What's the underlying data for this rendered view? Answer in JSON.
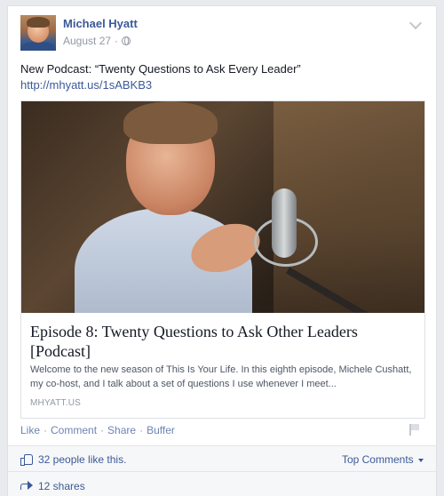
{
  "post": {
    "author": "Michael Hyatt",
    "date": "August 27",
    "date_sep": "·",
    "text": "New Podcast: “Twenty Questions to Ask Every Leader”",
    "link": "http://mhyatt.us/1sABKB3"
  },
  "share": {
    "title": "Episode 8: Twenty Questions to Ask Other Leaders [Podcast]",
    "description": "Welcome to the new season of This Is Your Life. In this eighth episode, Michele Cushatt, my co-host, and I talk about a set of questions I use whenever I meet...",
    "domain": "MHYATT.US"
  },
  "actions": {
    "like": "Like",
    "comment": "Comment",
    "share": "Share",
    "buffer": "Buffer",
    "sep": "·"
  },
  "ufi": {
    "likes": "32 people like this.",
    "top_comments": "Top Comments",
    "shares": "12 shares"
  },
  "colors": {
    "link": "#3b5998",
    "background": "#e9eaed",
    "ufi_background": "#f6f7f8"
  },
  "icons": [
    "globe-icon",
    "chevron-down-icon",
    "flag-icon",
    "thumb-icon",
    "share-arrow-icon",
    "caret-icon"
  ]
}
